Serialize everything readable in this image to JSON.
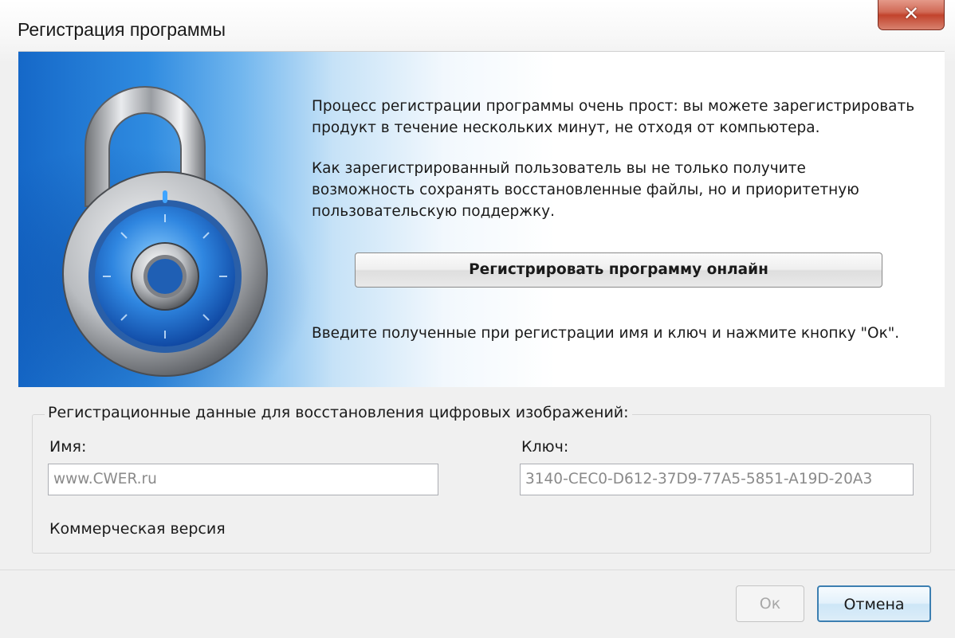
{
  "window": {
    "title": "Регистрация программы",
    "close_icon": "close-icon",
    "close_glyph": "✕"
  },
  "banner": {
    "paragraph1_line1": "Процесс регистрации программы очень прост: вы можете зарегистрировать",
    "paragraph1_line2": "продукт в течение нескольких минут, не отходя от компьютера.",
    "paragraph2_line1": "Как зарегистрированный пользователь вы не только получите",
    "paragraph2_line2": "возможность сохранять восстановленные файлы, но и приоритетную",
    "paragraph2_line3": "пользовательскую поддержку.",
    "register_online_label": "Регистрировать программу онлайн",
    "instruction": "Введите полученные при регистрации имя и ключ и нажмите кнопку \"Ок\".",
    "image_icon": "padlock-icon"
  },
  "registration": {
    "group_label": "Регистрационные данные для восстановления цифровых изображений:",
    "name_label": "Имя:",
    "name_value": "www.CWER.ru",
    "key_label": "Ключ:",
    "key_value": "3140-CEC0-D612-37D9-77A5-5851-A19D-20A3",
    "version": "Коммерческая версия"
  },
  "buttons": {
    "ok_label": "Ок",
    "cancel_label": "Отмена"
  }
}
